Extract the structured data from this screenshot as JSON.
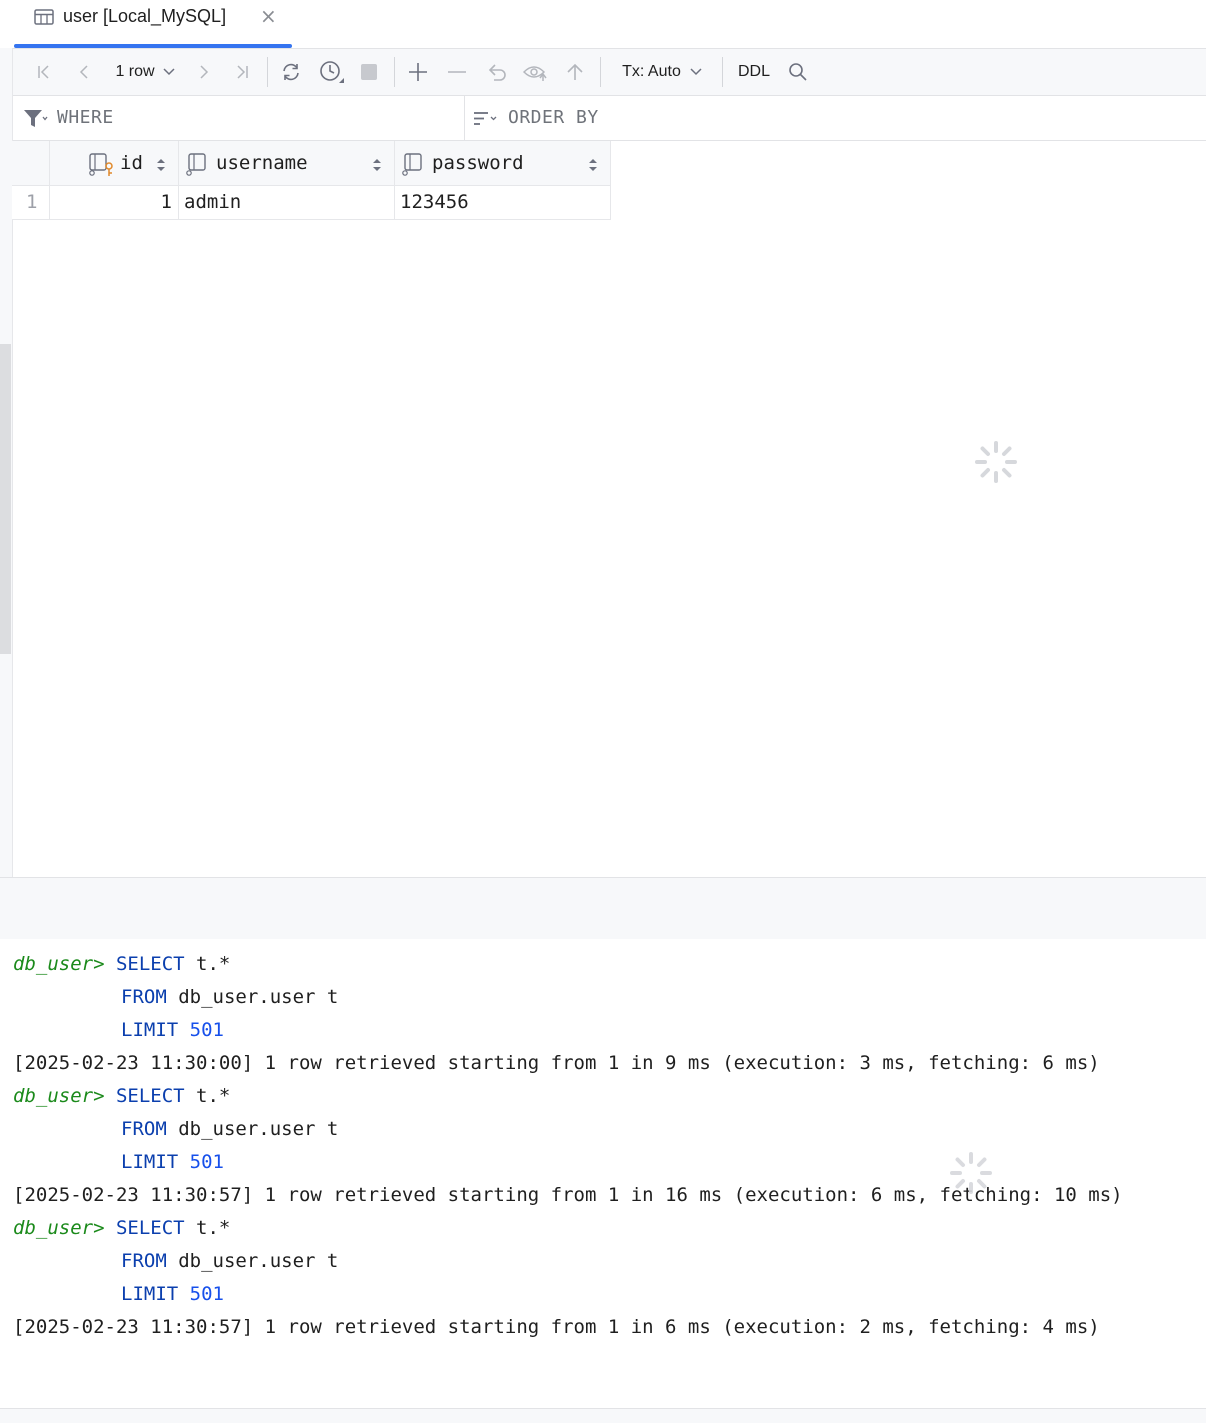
{
  "tab": {
    "title": "user [Local_MySQL]",
    "close": "×"
  },
  "toolbar": {
    "rows_label": "1 row",
    "tx_label": "Tx: Auto",
    "ddl_label": "DDL"
  },
  "filter": {
    "where": "WHERE",
    "order_by": "ORDER BY"
  },
  "table": {
    "columns": [
      "id",
      "username",
      "password"
    ],
    "rows": [
      {
        "row_num": "1",
        "id": "1",
        "username": "admin",
        "password": "123456"
      }
    ]
  },
  "console": {
    "prompt": "db_user>",
    "entries": [
      {
        "select": "SELECT",
        "select_rest": " t.*",
        "from": "FROM",
        "from_rest": " db_user.user t",
        "limit": "LIMIT",
        "limit_value": "501",
        "result": "[2025-02-23 11:30:00] 1 row retrieved starting from 1 in 9 ms (execution: 3 ms, fetching: 6 ms)"
      },
      {
        "select": "SELECT",
        "select_rest": " t.*",
        "from": "FROM",
        "from_rest": " db_user.user t",
        "limit": "LIMIT",
        "limit_value": "501",
        "result": "[2025-02-23 11:30:57] 1 row retrieved starting from 1 in 16 ms (execution: 6 ms, fetching: 10 ms)"
      },
      {
        "select": "SELECT",
        "select_rest": " t.*",
        "from": "FROM",
        "from_rest": " db_user.user t",
        "limit": "LIMIT",
        "limit_value": "501",
        "result": "[2025-02-23 11:30:57] 1 row retrieved starting from 1 in 6 ms (execution: 2 ms, fetching: 4 ms)"
      }
    ]
  },
  "colors": {
    "accent": "#3574f0",
    "keyword": "#0b3fae",
    "number": "#1750eb",
    "prompt": "#1b8a1b"
  }
}
